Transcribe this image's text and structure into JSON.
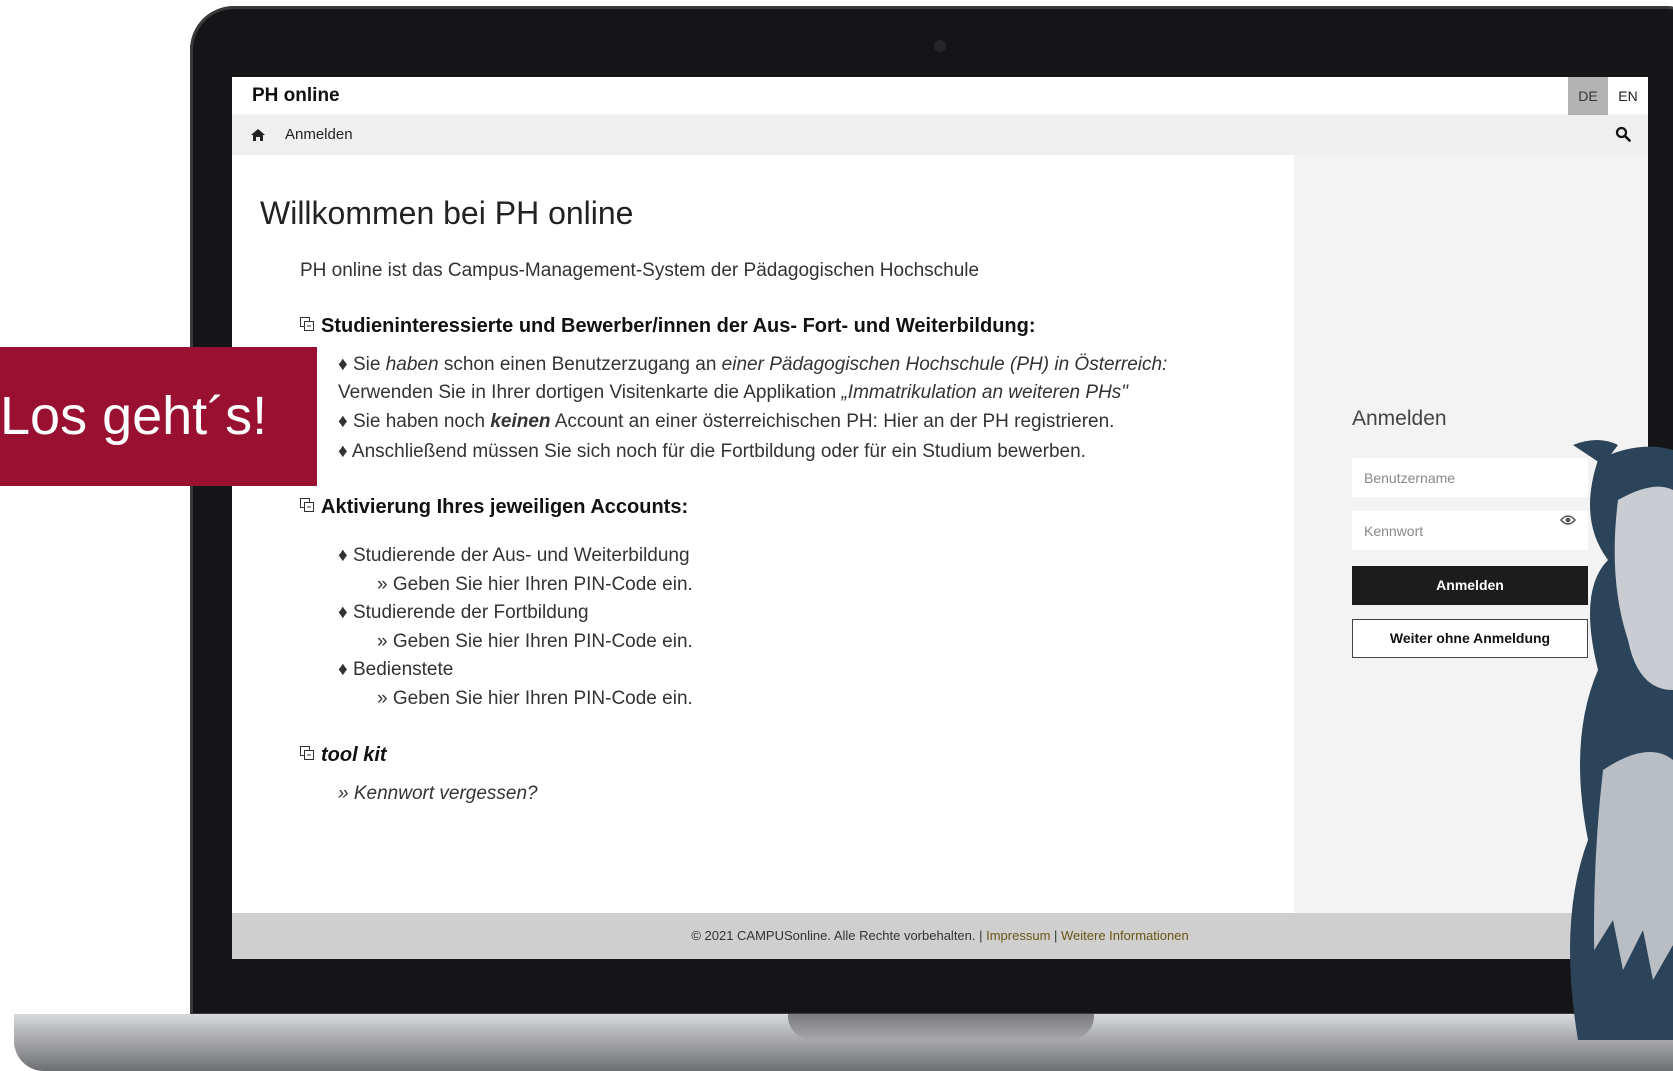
{
  "app": {
    "title": "PH online"
  },
  "lang": {
    "de": "DE",
    "en": "EN"
  },
  "nav": {
    "label": "Anmelden"
  },
  "main": {
    "heading": "Willkommen bei PH online",
    "intro": "PH online ist das Campus-Management-System der Pädagogischen Hochschule",
    "section1": {
      "title": "Studieninteressierte und Bewerber/innen der Aus- Fort- und Weiterbildung:",
      "l1a": "♦ Sie ",
      "l1b": "haben",
      "l1c": " schon einen Benutzerzugang an ",
      "l1d": "einer Pädagogischen Hochschule (PH) in Österreich:",
      "l2a": "Verwenden Sie in Ihrer dortigen Visitenkarte die Applikation ",
      "l2b": "„Immatrikulation an weiteren PHs\"",
      "l3a": "♦ Sie haben noch ",
      "l3b": "keinen",
      "l3c": " Account an einer österreichischen PH: Hier an der PH registrieren.",
      "l4": "♦ Anschließend müssen Sie sich noch für die Fortbildung oder für ein Studium bewerben."
    },
    "section2": {
      "title": "Aktivierung Ihres jeweiligen Accounts:",
      "items": [
        {
          "label": "♦ Studierende der Aus- und Weiterbildung",
          "link": "» Geben Sie hier Ihren PIN-Code ein."
        },
        {
          "label": "♦ Studierende der Fortbildung",
          "link": "» Geben Sie hier Ihren PIN-Code ein."
        },
        {
          "label": "♦ Bedienstete",
          "link": "» Geben Sie hier Ihren PIN-Code ein."
        }
      ]
    },
    "section3": {
      "title": "tool kit",
      "link": "» Kennwort vergessen?"
    }
  },
  "login": {
    "title": "Anmelden",
    "username_placeholder": "Benutzername",
    "password_placeholder": "Kennwort",
    "submit": "Anmelden",
    "guest": "Weiter ohne Anmeldung"
  },
  "footer": {
    "copyright": "© 2021 CAMPUSonline. Alle Rechte vorbehalten. | ",
    "impressum": "Impressum",
    "sep": " | ",
    "more": "Weitere Informationen"
  },
  "banner": {
    "text": "Los geht´s!"
  },
  "colors": {
    "banner": "#9a1030",
    "footer_link": "#6b5513",
    "button": "#1c1c1c"
  }
}
